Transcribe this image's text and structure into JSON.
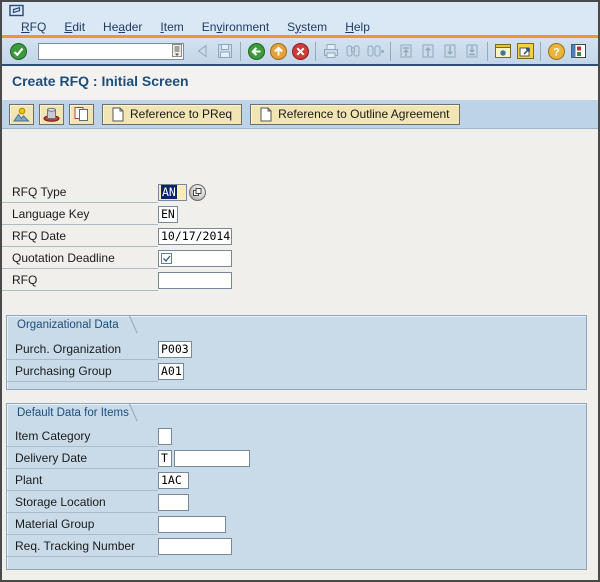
{
  "colors": {
    "accent_orange": "#E89B2D",
    "menu_blue_bg": "#DAE7F5",
    "toolbar_blue_bg": "#C9DAEB",
    "app_toolbar_bg": "#BDD3E7",
    "groupbox_bg": "#C9DBE9",
    "title_text": "#1C4E7C",
    "field_yellow": "#F9EDBB",
    "selection_navy": "#0A246A",
    "button_beige": "#F2E5B4"
  },
  "menu_bar": {
    "items": [
      {
        "pre": "",
        "key": "R",
        "post": "FQ"
      },
      {
        "pre": "",
        "key": "E",
        "post": "dit"
      },
      {
        "pre": "He",
        "key": "a",
        "post": "der"
      },
      {
        "pre": "",
        "key": "I",
        "post": "tem"
      },
      {
        "pre": "En",
        "key": "v",
        "post": "ironment"
      },
      {
        "pre": "S",
        "key": "y",
        "post": "stem"
      },
      {
        "pre": "",
        "key": "H",
        "post": "elp"
      }
    ]
  },
  "toolbar": {
    "command_field_value": "",
    "icons": [
      {
        "name": "enter-icon",
        "enabled": true
      },
      {
        "name": "command-field",
        "enabled": true
      },
      {
        "name": "previous-item-icon",
        "enabled": false
      },
      {
        "name": "save-icon",
        "enabled": false
      },
      {
        "name": "back-icon",
        "enabled": true
      },
      {
        "name": "exit-icon",
        "enabled": true
      },
      {
        "name": "cancel-icon",
        "enabled": true
      },
      {
        "name": "print-icon",
        "enabled": false
      },
      {
        "name": "find-icon",
        "enabled": false
      },
      {
        "name": "find-next-icon",
        "enabled": false
      },
      {
        "name": "first-page-icon",
        "enabled": false
      },
      {
        "name": "previous-page-icon",
        "enabled": false
      },
      {
        "name": "next-page-icon",
        "enabled": false
      },
      {
        "name": "last-page-icon",
        "enabled": false
      },
      {
        "name": "new-session-icon",
        "enabled": true
      },
      {
        "name": "create-shortcut-icon",
        "enabled": true
      },
      {
        "name": "help-icon",
        "enabled": true
      },
      {
        "name": "customize-layout-icon",
        "enabled": true
      }
    ]
  },
  "title_bar": {
    "title": "Create RFQ : Initial Screen"
  },
  "app_toolbar": {
    "overview_icon": "overview-icon",
    "header_icon": "header-hat-icon",
    "item_overview_icon": "item-overview-icon",
    "reference_preq_label": "Reference to PReq",
    "reference_outline_label": "Reference to Outline Agreement"
  },
  "form": {
    "fields": [
      {
        "label": "RFQ Type",
        "value": "AN"
      },
      {
        "label": "Language Key",
        "value": "EN"
      },
      {
        "label": "RFQ Date",
        "value": "10/17/2014"
      },
      {
        "label": "Quotation Deadline",
        "value": "",
        "required": true
      },
      {
        "label": "RFQ",
        "value": ""
      }
    ]
  },
  "org_group": {
    "title": "Organizational Data",
    "fields": [
      {
        "label": "Purch. Organization",
        "value": "P003"
      },
      {
        "label": "Purchasing Group",
        "value": "A01"
      }
    ]
  },
  "items_group": {
    "title": "Default Data for Items",
    "fields": [
      {
        "label": "Item Category",
        "value": ""
      },
      {
        "label": "Delivery Date",
        "value": "T",
        "value2": ""
      },
      {
        "label": "Plant",
        "value": "1AC"
      },
      {
        "label": "Storage Location",
        "value": ""
      },
      {
        "label": "Material Group",
        "value": ""
      },
      {
        "label": "Req. Tracking Number",
        "value": ""
      }
    ]
  }
}
